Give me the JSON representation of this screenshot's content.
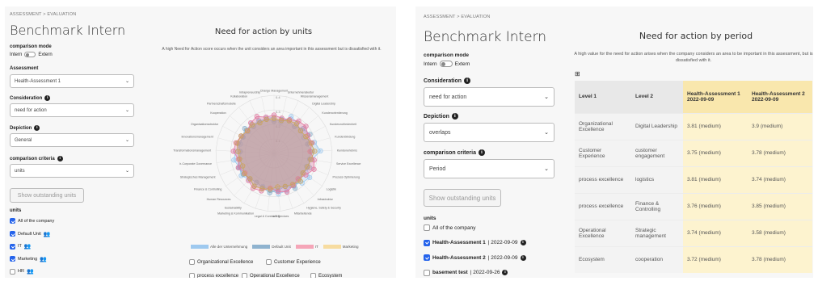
{
  "left": {
    "breadcrumb": "ASSESSMENT > EVALUATION",
    "title": "Benchmark Intern",
    "comparison_mode": {
      "label": "comparison mode",
      "left": "Intern",
      "right": "Extern"
    },
    "assessment": {
      "label": "Assessment",
      "value": "Health-Assessment 1"
    },
    "consideration": {
      "label": "Consideration",
      "value": "need for action"
    },
    "depiction": {
      "label": "Depiction",
      "value": "General"
    },
    "criteria": {
      "label": "comparison criteria",
      "value": "units"
    },
    "show_button": "Show outstanding units",
    "units": {
      "label": "units",
      "items": [
        {
          "label": "All of the company",
          "checked": true,
          "people": false
        },
        {
          "label": "Default Unit",
          "checked": true,
          "people": true
        },
        {
          "label": "IT",
          "checked": true,
          "people": true
        },
        {
          "label": "Marketing",
          "checked": true,
          "people": true
        },
        {
          "label": "HR",
          "checked": false,
          "people": true
        }
      ]
    },
    "chart_title": "Need for action by units",
    "chart_subtitle": "A high Need for Action score occurs when the unit considers an area important in this assessment but is dissatisfied with it.",
    "radar_labels": [
      "Change Management",
      "Unternehmenskultur",
      "Wissensmanagement",
      "Digital Leadership",
      "Kundenorientierung",
      "Kundenzufriedenheit",
      "Kundenbindung",
      "Kundenerlebnis",
      "Service Excellence",
      "Prozess Optimierung",
      "Logistik",
      "Infrastruktur",
      "Hygiene, Safety & Security",
      "Mitarbeitende",
      "IoT Services",
      "Legal & Contracting",
      "Marketing & Kommunikation",
      "Sustainability",
      "Human Resources",
      "Finance & Controlling",
      "Strategisches Management",
      "Ir-Corporate Governance",
      "Transformationsmanagement",
      "Innovationsmanagement",
      "Organisationsstruktur",
      "Kooperation",
      "Partnerschaftsmodelle",
      "Kollaboration",
      "Intrapreneurship"
    ],
    "radar_ticks": [
      "0.4",
      "0.3",
      "0.2",
      "0.1"
    ],
    "legend": [
      {
        "label": "Alle der Unternehmung",
        "color": "#9ec9ef"
      },
      {
        "label": "Default Unit",
        "color": "#8fb3cf"
      },
      {
        "label": "IT",
        "color": "#f5a6b8"
      },
      {
        "label": "Marketing",
        "color": "#f7dca0"
      }
    ],
    "filters": [
      "Organizational Excellence",
      "Customer Experience",
      "process excellence",
      "Operational Excellence",
      "Ecosystem"
    ]
  },
  "right": {
    "breadcrumb": "ASSESSMENT > EVALUATION",
    "title": "Benchmark Intern",
    "comparison_mode": {
      "label": "comparison mode",
      "left": "Intern",
      "right": "Extern"
    },
    "consideration": {
      "label": "Consideration",
      "value": "need for action"
    },
    "depiction": {
      "label": "Depiction",
      "value": "overlaps"
    },
    "criteria": {
      "label": "comparison criteria",
      "value": "Period"
    },
    "show_button": "Show outstanding units",
    "units": {
      "label": "units",
      "items": [
        {
          "label": "All of the company",
          "checked": false,
          "date": ""
        },
        {
          "label": "Health-Assessment 1",
          "checked": true,
          "date": "2022-09-09"
        },
        {
          "label": "Health-Assessment 2",
          "checked": true,
          "date": "2022-09-09"
        },
        {
          "label": "basement test",
          "checked": false,
          "date": "2022-09-26"
        }
      ]
    },
    "chart_title": "Need for action by period",
    "chart_subtitle": "A high value for the need for action arises when the company considers an area to be important in this assessment, but is dissatisfied with it.",
    "table": {
      "headers": [
        "Level 1",
        "Level 2",
        "Health-Assessment 1\n2022-09-09",
        "Health-Assessment 2\n2022-09-09"
      ],
      "rows": [
        [
          "Organizational Excellence",
          "Digital Leadership",
          "3.81 (medium)",
          "3.9 (medium)"
        ],
        [
          "Customer Experience",
          "customer engagement",
          "3.75 (medium)",
          "3.78 (medium)"
        ],
        [
          "process excellence",
          "logistics",
          "3.81 (medium)",
          "3.74 (medium)"
        ],
        [
          "process excellence",
          "Finance & Controlling",
          "3.76 (medium)",
          "3.85 (medium)"
        ],
        [
          "Operational Excellence",
          "Strategic management",
          "3.74 (medium)",
          "3.58 (medium)"
        ],
        [
          "Ecosystem",
          "cooperation",
          "3.72 (medium)",
          "3.78 (medium)"
        ]
      ]
    }
  }
}
